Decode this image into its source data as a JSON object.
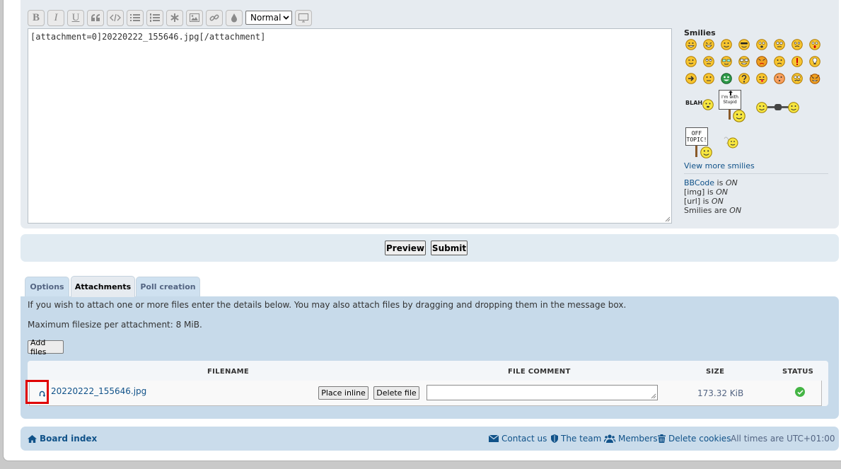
{
  "toolbar": {
    "buttons": [
      {
        "name": "bold",
        "glyph": "B"
      },
      {
        "name": "italic",
        "glyph": "I"
      },
      {
        "name": "underline",
        "glyph": "U"
      }
    ],
    "font_size_value": "Normal",
    "icons": [
      "quote-icon",
      "code-icon",
      "list-icon",
      "ordered-list-icon",
      "asterisk-icon",
      "image-icon",
      "link-icon",
      "color-drop-icon",
      "monitor-icon"
    ]
  },
  "editor": {
    "content": "[attachment=0]20220222_155646.jpg[/attachment]"
  },
  "smilies": {
    "title": "Smilies",
    "view_more": "View more smilies",
    "status": [
      {
        "link": "BBCode",
        "text": " is ",
        "state": "ON"
      },
      {
        "link": "",
        "text": "[img] is ",
        "state": "ON"
      },
      {
        "link": "",
        "text": "[url] is ",
        "state": "ON"
      },
      {
        "link": "",
        "text": "Smilies are ",
        "state": "ON"
      }
    ],
    "sign_stupid": "I'm with Stupid",
    "sign_blah": "BLAH",
    "sign_off_topic": "OFF TOPIC!"
  },
  "actions": {
    "preview": "Preview",
    "submit": "Submit"
  },
  "tabs": [
    {
      "label": "Options",
      "active": false
    },
    {
      "label": "Attachments",
      "active": true
    },
    {
      "label": "Poll creation",
      "active": false
    }
  ],
  "attachments": {
    "intro": "If you wish to attach one or more files enter the details below. You may also attach files by dragging and dropping them in the message box.",
    "max_size": "Maximum filesize per attachment: 8 MiB.",
    "add_files": "Add files",
    "columns": {
      "filename": "FILENAME",
      "comment": "FILE COMMENT",
      "size": "SIZE",
      "status": "STATUS"
    },
    "files": [
      {
        "name": "20220222_155646.jpg",
        "place_inline": "Place inline",
        "delete": "Delete file",
        "comment": "",
        "size": "173.32 KiB",
        "status": "ok"
      }
    ]
  },
  "footer": {
    "board_index": "Board index",
    "contact": "Contact us",
    "team": "The team",
    "members": "Members",
    "delete_cookies": "Delete cookies",
    "timezone": "All times are UTC+01:00"
  },
  "colors": {
    "link": "#105289",
    "panel": "#e6ebf0",
    "highlight": "#e00000",
    "status_ok": "#45b545"
  }
}
